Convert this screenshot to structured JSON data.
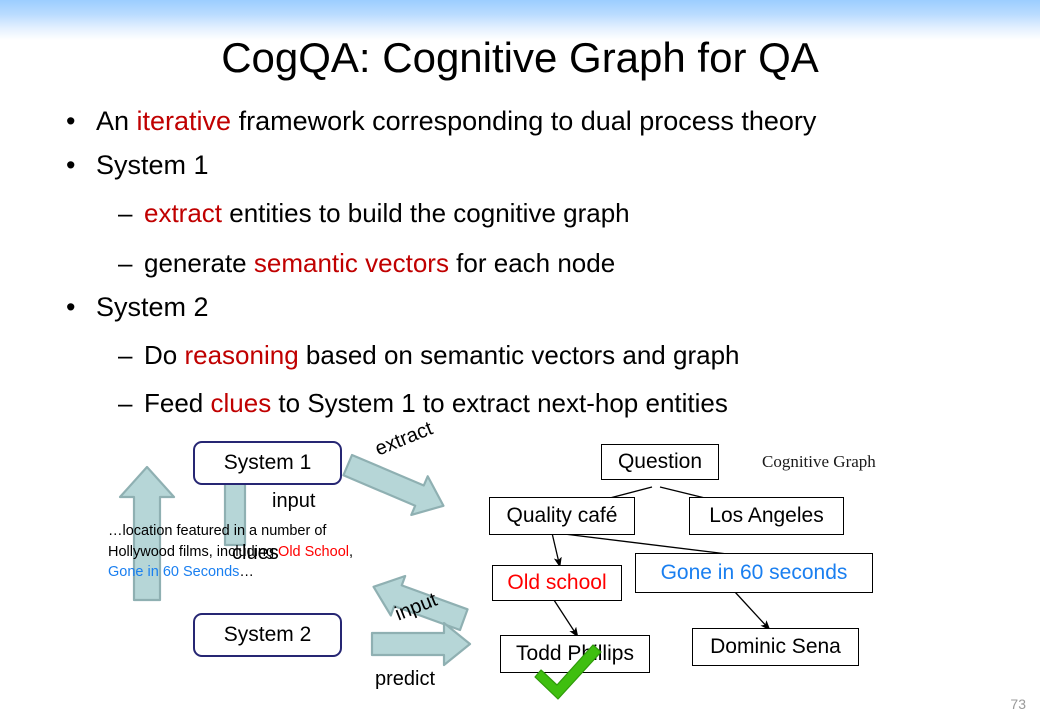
{
  "slide": {
    "title": "CogQA: Cognitive Graph for QA",
    "page_number": "73",
    "accent_red": "#c00000",
    "node_red": "#ff0000",
    "node_blue": "#1a7ff0",
    "box_navy": "#262673",
    "arrow_fill": "#b6d6d7",
    "arrow_stroke": "#8fb0b2",
    "check_green": "#3fbf0f",
    "band_blue": "#9ccdff"
  },
  "bullets": [
    {
      "level": 1,
      "marker": "•",
      "parts": [
        {
          "t": "An ",
          "c": "black"
        },
        {
          "t": "iterative",
          "c": "red"
        },
        {
          "t": " framework corresponding to dual process theory",
          "c": "black"
        }
      ]
    },
    {
      "level": 1,
      "marker": "•",
      "parts": [
        {
          "t": "System 1",
          "c": "black"
        }
      ]
    },
    {
      "level": 2,
      "marker": "–",
      "parts": [
        {
          "t": "extract",
          "c": "red"
        },
        {
          "t": " entities to build the cognitive graph",
          "c": "black"
        }
      ]
    },
    {
      "level": 2,
      "marker": "–",
      "parts": [
        {
          "t": "generate ",
          "c": "black"
        },
        {
          "t": "semantic vectors",
          "c": "red"
        },
        {
          "t": " for each node",
          "c": "black"
        }
      ]
    },
    {
      "level": 1,
      "marker": "•",
      "parts": [
        {
          "t": "System 2",
          "c": "black"
        }
      ]
    },
    {
      "level": 2,
      "marker": "–",
      "parts": [
        {
          "t": "Do ",
          "c": "black"
        },
        {
          "t": "reasoning",
          "c": "red"
        },
        {
          "t": " based on semantic vectors and graph",
          "c": "black"
        }
      ]
    },
    {
      "level": 2,
      "marker": "–",
      "parts": [
        {
          "t": "Feed ",
          "c": "black"
        },
        {
          "t": "clues",
          "c": "red"
        },
        {
          "t": " to System 1 to extract next-hop entities",
          "c": "black"
        }
      ]
    }
  ],
  "diagram": {
    "system_boxes": [
      {
        "id": "system-1",
        "label": "System 1"
      },
      {
        "id": "system-2",
        "label": "System 2"
      }
    ],
    "arrow_labels": [
      {
        "id": "extract",
        "label": "extract"
      },
      {
        "id": "input-top",
        "label": "input"
      },
      {
        "id": "clues",
        "label": "clues"
      },
      {
        "id": "input-bottom",
        "label": "input"
      },
      {
        "id": "predict",
        "label": "predict"
      }
    ],
    "snippet": {
      "line1": "…location featured in a number of",
      "line2a": "Hollywood films, including ",
      "line2b": "Old School",
      "line2c": ",",
      "line3a": "Gone in 60 Seconds",
      "line3b": "…"
    }
  },
  "cognitive_graph": {
    "caption": "Cognitive Graph",
    "nodes": [
      {
        "id": "question",
        "label": "Question",
        "color": "black"
      },
      {
        "id": "quality-cafe",
        "label": "Quality café",
        "color": "black"
      },
      {
        "id": "los-angeles",
        "label": "Los Angeles",
        "color": "black"
      },
      {
        "id": "old-school",
        "label": "Old school",
        "color": "red"
      },
      {
        "id": "gone-60",
        "label": "Gone in 60 seconds",
        "color": "blue"
      },
      {
        "id": "todd-phillips",
        "label": "Todd Phillips",
        "color": "black"
      },
      {
        "id": "dominic-sena",
        "label": "Dominic Sena",
        "color": "black"
      }
    ],
    "edges": [
      {
        "from": "question",
        "to": "quality-cafe"
      },
      {
        "from": "question",
        "to": "los-angeles"
      },
      {
        "from": "quality-cafe",
        "to": "old-school"
      },
      {
        "from": "quality-cafe",
        "to": "gone-60"
      },
      {
        "from": "old-school",
        "to": "todd-phillips"
      },
      {
        "from": "gone-60",
        "to": "dominic-sena"
      }
    ],
    "answer_marker": {
      "node": "todd-phillips",
      "symbol": "check"
    }
  }
}
